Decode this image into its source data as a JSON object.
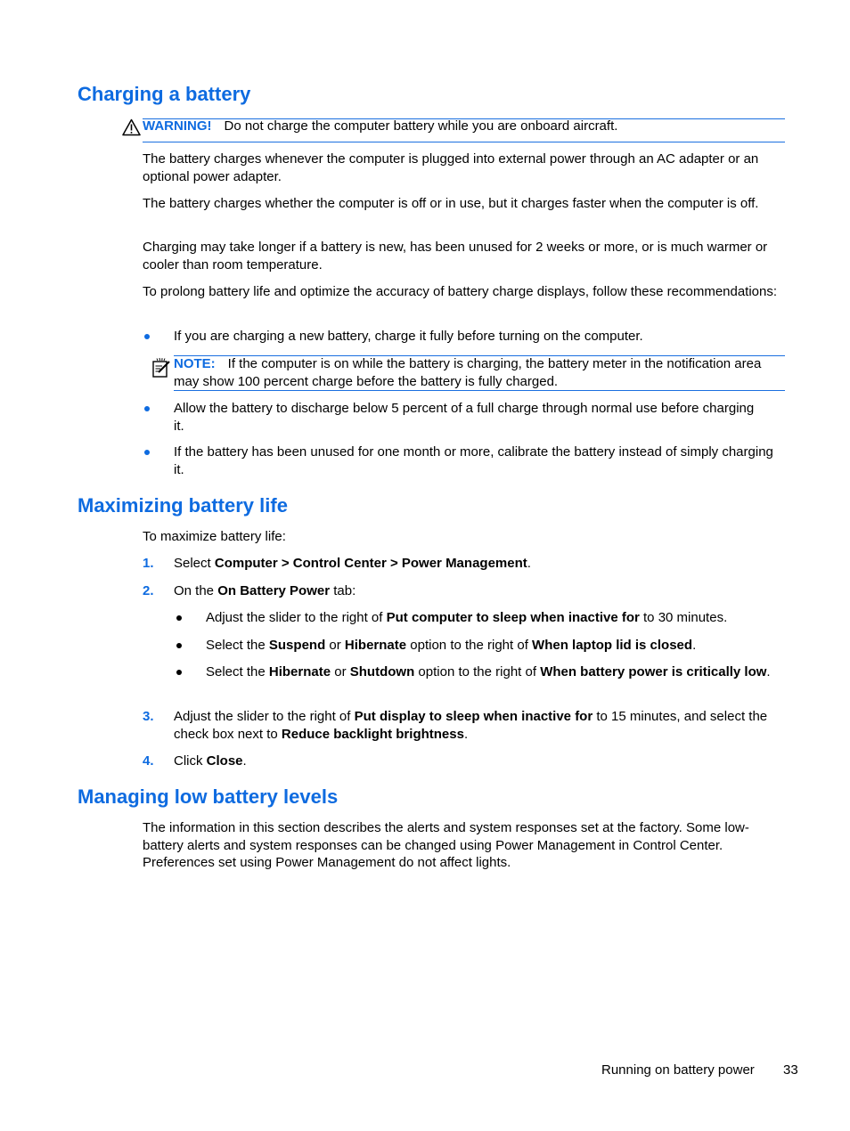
{
  "sections": {
    "charging": {
      "title": "Charging a battery",
      "warning": {
        "icon": "warning-triangle-icon",
        "label": "WARNING!",
        "text": "Do not charge the computer battery while you are onboard aircraft."
      },
      "paragraphs": [
        "The battery charges whenever the computer is plugged into external power through an AC adapter or an optional power adapter.",
        "The battery charges whether the computer is off or in use, but it charges faster when the computer is off.",
        "Charging may take longer if a battery is new, has been unused for 2 weeks or more, or is much warmer or cooler than room temperature.",
        "To prolong battery life and optimize the accuracy of battery charge displays, follow these recommendations:"
      ],
      "bullets": [
        "If you are charging a new battery, charge it fully before turning on the computer.",
        "Allow the battery to discharge below 5 percent of a full charge through normal use before charging it.",
        "If the battery has been unused for one month or more, calibrate the battery instead of simply charging it."
      ],
      "note": {
        "icon": "note-pencil-icon",
        "label": "NOTE:",
        "text": "If the computer is on while the battery is charging, the battery meter in the notification area may show 100 percent charge before the battery is fully charged."
      }
    },
    "maximizing": {
      "title": "Maximizing battery life",
      "intro": "To maximize battery life:",
      "steps": [
        {
          "num": "1.",
          "pre": "Select ",
          "b1": "Computer > Control Center > Power Management",
          "post": "."
        },
        {
          "num": "2.",
          "pre": "On the ",
          "b1": "On Battery Power",
          "post": " tab:"
        },
        {
          "num": "3.",
          "pre": "Adjust the slider to the right of ",
          "b1": "Put display to sleep when inactive for",
          "mid": " to 15 minutes, and select the check box next to ",
          "b2": "Reduce backlight brightness",
          "post": "."
        },
        {
          "num": "4.",
          "pre": "Click ",
          "b1": "Close",
          "post": "."
        }
      ],
      "substeps": [
        {
          "pre": "Adjust the slider to the right of ",
          "b1": "Put computer to sleep when inactive for",
          "post": " to 30 minutes."
        },
        {
          "pre": "Select the ",
          "b1": "Suspend",
          "mid": " or ",
          "b2": "Hibernate",
          "mid2": " option to the right of ",
          "b3": "When laptop lid is closed",
          "post": "."
        },
        {
          "pre": "Select the ",
          "b1": "Hibernate",
          "mid": " or ",
          "b2": "Shutdown",
          "mid2": " option to the right of ",
          "b3": "When battery power is critically low",
          "post": "."
        }
      ]
    },
    "managing": {
      "title": "Managing low battery levels",
      "paragraph": "The information in this section describes the alerts and system responses set at the factory. Some low-battery alerts and system responses can be changed using Power Management in Control Center. Preferences set using Power Management do not affect lights."
    }
  },
  "footer": {
    "chapter": "Running on battery power",
    "page_number": "33"
  },
  "colors": {
    "accent": "#0e6be0",
    "text": "#000000"
  }
}
